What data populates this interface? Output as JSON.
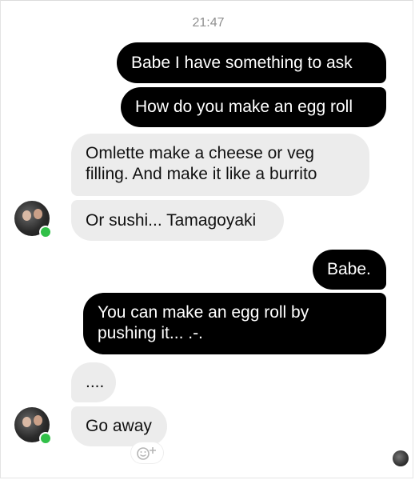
{
  "thread": {
    "timestamp": "21:47",
    "messages": [
      {
        "from": "me",
        "text": "Babe I have something to ask"
      },
      {
        "from": "me",
        "text": "How do you make an egg roll"
      },
      {
        "from": "them",
        "text": "Omlette make a cheese or veg filling. And make it like a burrito"
      },
      {
        "from": "them",
        "text": "Or sushi... Tamagoyaki"
      },
      {
        "from": "me",
        "text": "Babe."
      },
      {
        "from": "me",
        "text": "You can make an egg roll by pushing it... .-."
      },
      {
        "from": "them",
        "text": "...."
      },
      {
        "from": "them",
        "text": "Go away"
      }
    ]
  },
  "icons": {
    "contact_avatar": "avatar-photo",
    "online_indicator": "green-dot",
    "reaction": "smiley-plus-icon",
    "read_receipt": "mini-avatar"
  },
  "colors": {
    "outgoing_bubble": "#000000",
    "incoming_bubble": "#ececec",
    "online": "#31c048"
  }
}
